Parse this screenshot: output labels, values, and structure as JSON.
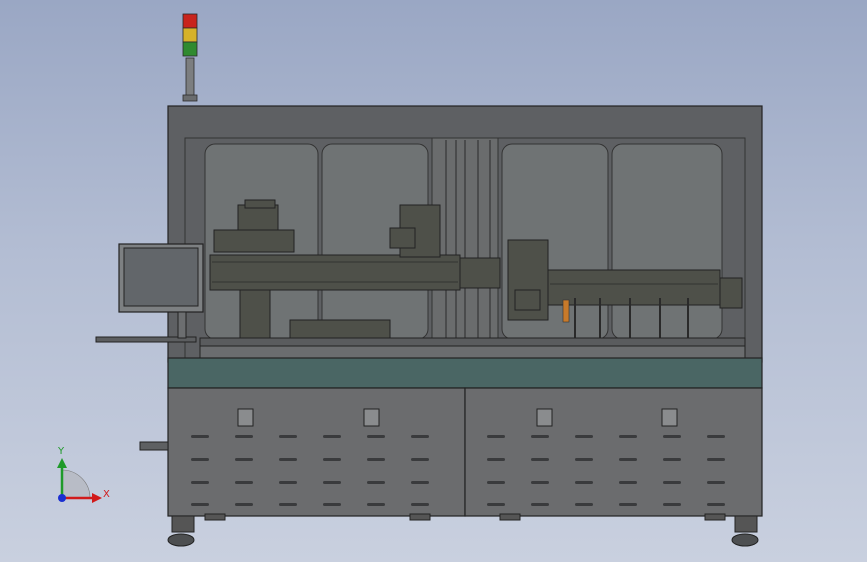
{
  "viewport": {
    "background_top": "#9aa7c4",
    "background_bottom": "#c9d0df"
  },
  "triad": {
    "x_label": "X",
    "y_label": "Y",
    "x_color": "#d11a1a",
    "y_color": "#1f9a2a",
    "z_color": "#1a2fd1"
  },
  "colors": {
    "frame": "#5e6063",
    "frame_dark": "#3a3b3d",
    "glass": "#6f7374",
    "deck": "#4a6664",
    "cabinet": "#6b6c6e",
    "machine": "#4e5049",
    "tower_red": "#c8241c",
    "tower_yellow": "#d6b22a",
    "tower_green": "#2f8a2f",
    "monitor_screen": "#62666a"
  }
}
